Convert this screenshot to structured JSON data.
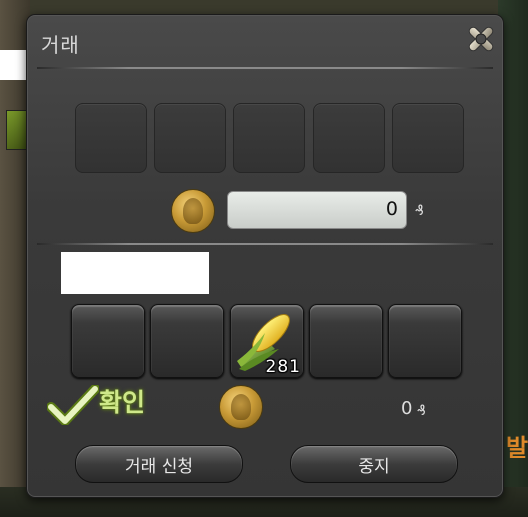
{
  "window": {
    "title": "거래"
  },
  "my_offer": {
    "slots": [
      "",
      "",
      "",
      "",
      ""
    ],
    "gil_value": "0",
    "gil_unit": "₰"
  },
  "partner_offer": {
    "slots": [
      {
        "item": "",
        "qty": ""
      },
      {
        "item": "",
        "qty": ""
      },
      {
        "item": "corn-icon",
        "qty": "281"
      },
      {
        "item": "",
        "qty": ""
      },
      {
        "item": "",
        "qty": ""
      }
    ],
    "confirm_label": "확인",
    "gil_value": "0",
    "gil_unit": "₰"
  },
  "buttons": {
    "request_trade": "거래 신청",
    "cancel": "중지"
  },
  "colors": {
    "confirm": "#cfe88a",
    "window_bg": "#3a3a3a",
    "coin": "#c89a36"
  }
}
